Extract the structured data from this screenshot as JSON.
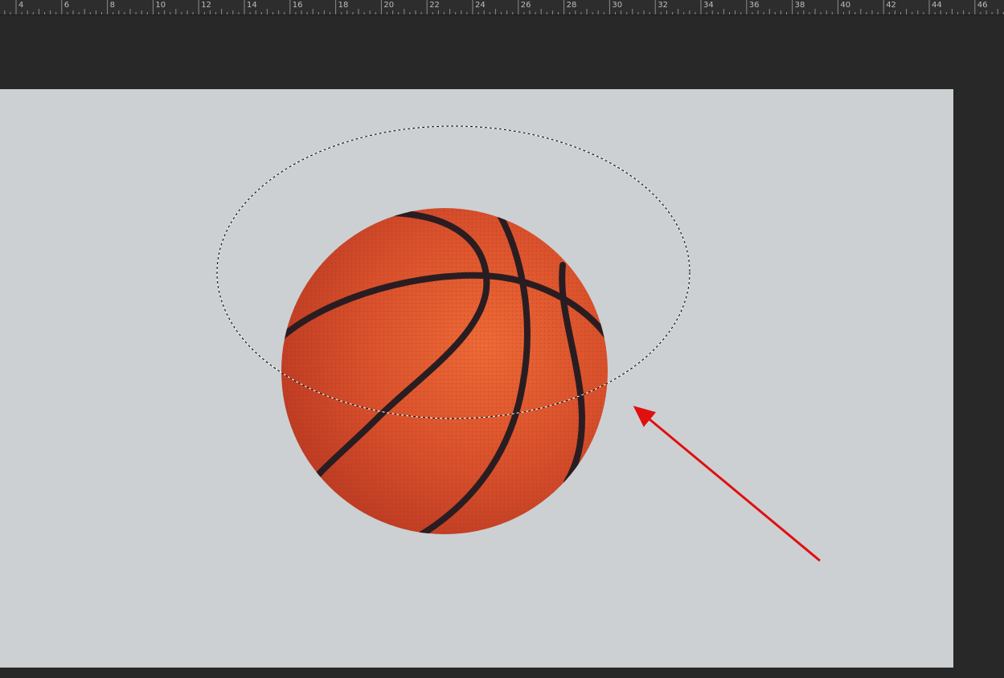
{
  "ruler": {
    "labels": [
      "4",
      "6",
      "8",
      "10",
      "12",
      "14",
      "16",
      "18",
      "20",
      "22",
      "24",
      "26",
      "28",
      "30",
      "32",
      "34",
      "36",
      "38",
      "40",
      "42",
      "44",
      "46"
    ]
  },
  "colors": {
    "workspace": "#282828",
    "ruler_bg": "#2d2d2d",
    "canvas": "#ccd0d2",
    "ball": "#d8502c",
    "ball_seam": "#2a1d22",
    "arrow": "#e01010"
  },
  "icons": {
    "ball": "basketball",
    "selection": "elliptical-marquee-selection",
    "annotation": "red-arrow"
  }
}
